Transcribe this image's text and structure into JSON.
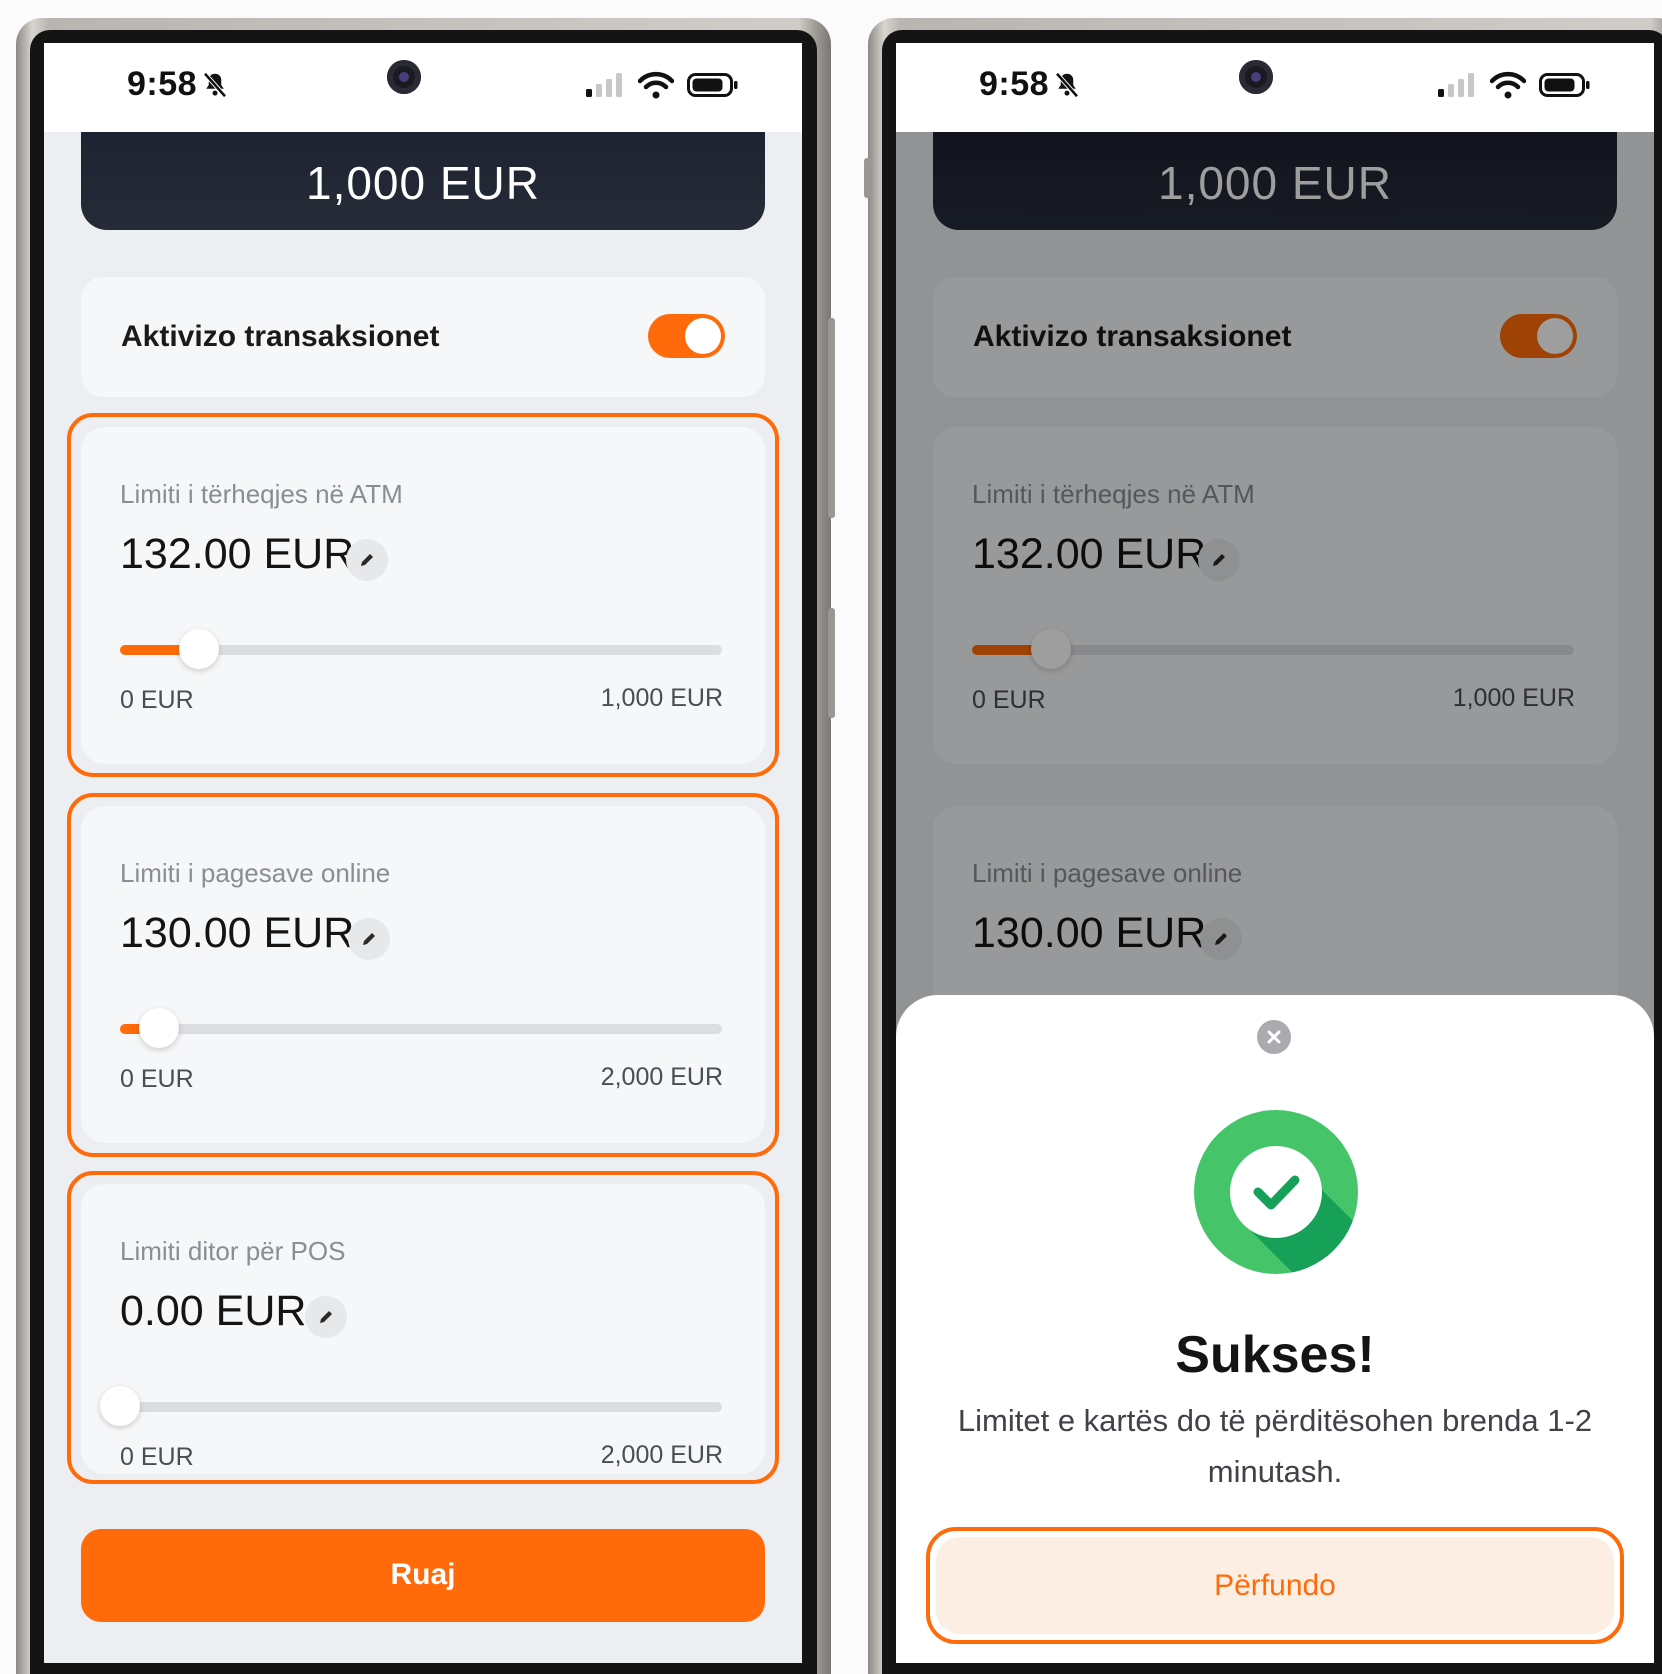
{
  "status": {
    "time": "9:58"
  },
  "balance": "1,000 EUR",
  "toggle": {
    "label": "Aktivizo transaksionet",
    "on": true
  },
  "limits": [
    {
      "title": "Limiti i tërheqjes në ATM",
      "amount": "132.00 EUR",
      "min": "0 EUR",
      "max": "1,000 EUR",
      "fraction": 0.132
    },
    {
      "title": "Limiti i pagesave online",
      "amount": "130.00 EUR",
      "min": "0 EUR",
      "max": "2,000 EUR",
      "fraction": 0.065
    },
    {
      "title": "Limiti ditor për POS",
      "amount": "0.00 EUR",
      "min": "0 EUR",
      "max": "2,000 EUR",
      "fraction": 0
    }
  ],
  "save_label": "Ruaj",
  "modal": {
    "title": "Sukses!",
    "message": "Limitet e kartës do të përditësohen brenda 1-2 minutash.",
    "button": "Përfundo"
  },
  "colors": {
    "accent": "#ff6b0a",
    "success": "#45c46a",
    "success_dark": "#17a058"
  }
}
